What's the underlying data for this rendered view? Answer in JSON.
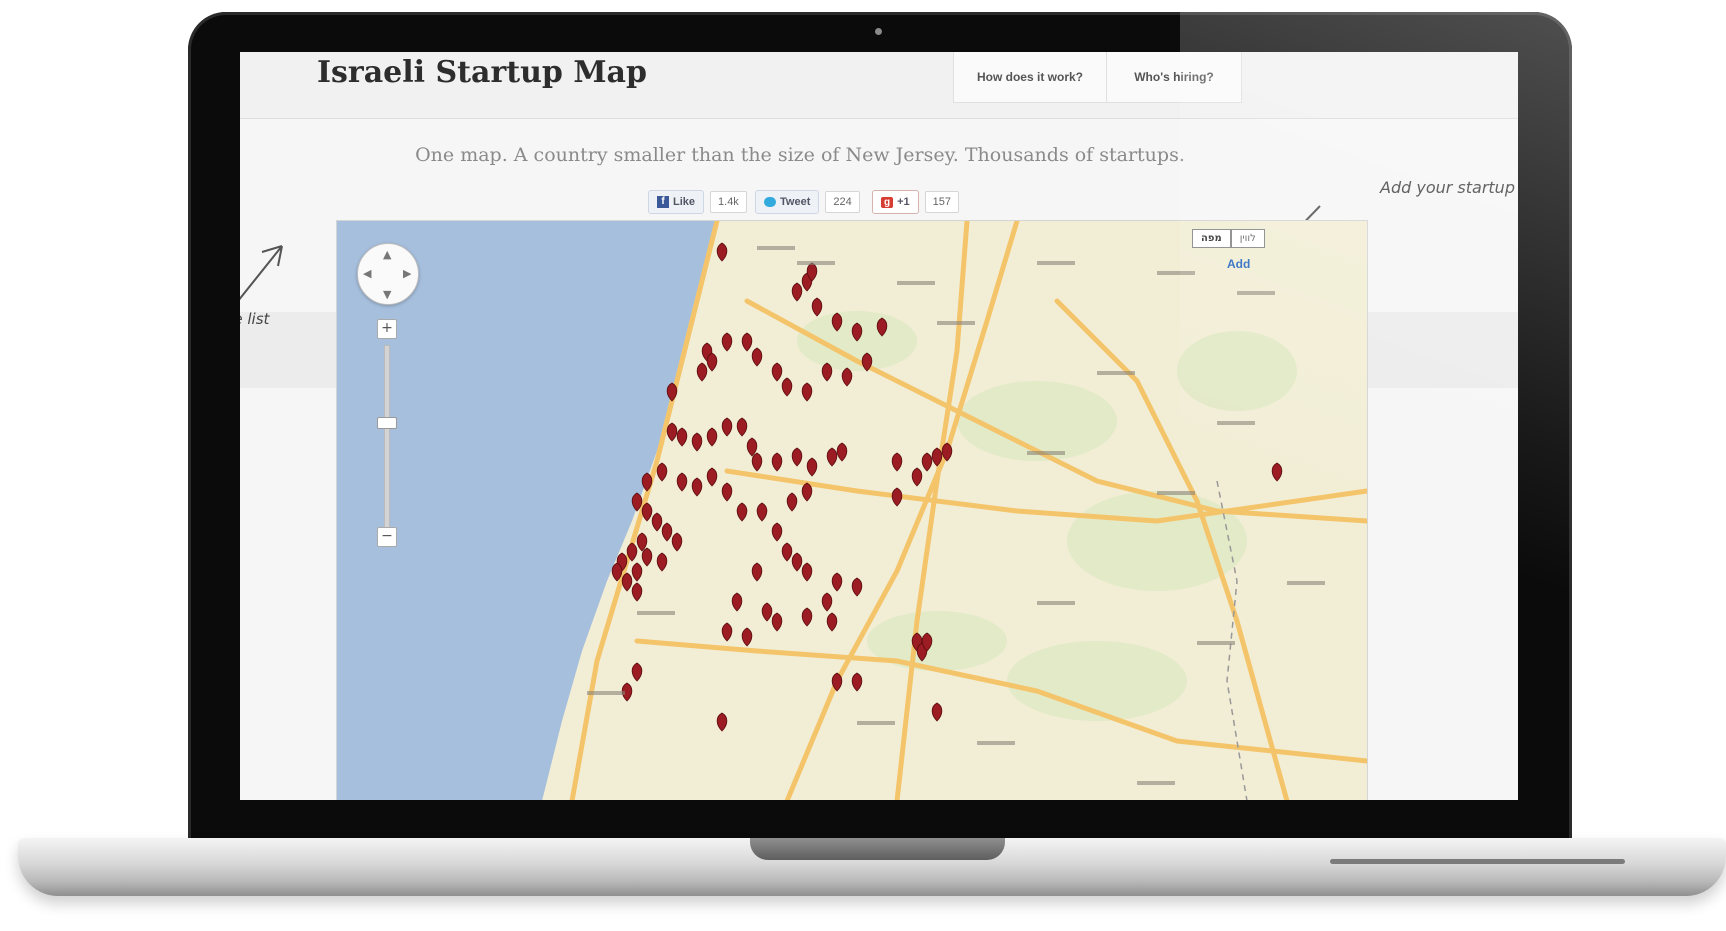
{
  "site": {
    "title": "Israeli Startup Map",
    "tagline": "One map. A country smaller than the size of New Jersey. Thousands of startups."
  },
  "nav": {
    "items": [
      {
        "label": "How does it work?"
      },
      {
        "label": "Who's hiring?"
      }
    ]
  },
  "social": {
    "facebook": {
      "label": "Like",
      "count": "1.4k"
    },
    "twitter": {
      "label": "Tweet",
      "count": "224"
    },
    "google": {
      "label": "+1",
      "count": "157"
    }
  },
  "annotations": {
    "add_startup": "Add your startup",
    "list": "the list"
  },
  "map": {
    "map_type_options": [
      "מפה",
      "לווין"
    ],
    "add_link": "Add",
    "zoom_in": "+",
    "zoom_out": "−",
    "colors": {
      "sea": "#a6bfdd",
      "land": "#f2eed6",
      "road": "#f4c46a",
      "marker": "#9b1c22"
    }
  }
}
